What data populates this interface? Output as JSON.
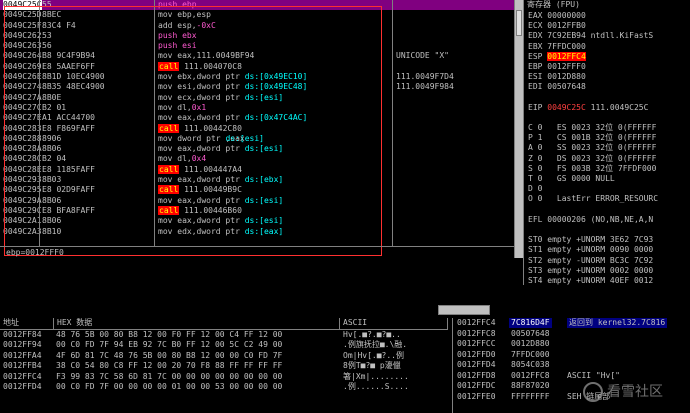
{
  "disasm": {
    "info": "ebp=0012FFF0",
    "lines": [
      {
        "addr": "0049C25C",
        "hex": "55",
        "asm": "push ebp",
        "kind": "push",
        "cmt": ""
      },
      {
        "addr": "0049C25D",
        "hex": "8BEC",
        "asm": "mov ebp,esp",
        "kind": "",
        "cmt": ""
      },
      {
        "addr": "0049C25F",
        "hex": "83C4 F4",
        "asm": "add esp,-0xC",
        "kind": "",
        "cmt": ""
      },
      {
        "addr": "0049C262",
        "hex": "53",
        "asm": "push ebx",
        "kind": "push",
        "cmt": ""
      },
      {
        "addr": "0049C263",
        "hex": "56",
        "asm": "push esi",
        "kind": "push",
        "cmt": ""
      },
      {
        "addr": "0049C264",
        "hex": "B8 9C4F9B94",
        "asm": "mov eax,111.0049BF94",
        "kind": "",
        "cmt": "UNICODE \"X\""
      },
      {
        "addr": "0049C269",
        "hex": "E8 5AAEF6FF",
        "asm": "111.004070C8",
        "kind": "call",
        "cmt": ""
      },
      {
        "addr": "0049C26E",
        "hex": "8B1D 10EC4900",
        "asm": "mov ebx,dword ptr ds:[0x49EC10]",
        "kind": "",
        "cmt": "111.0049F7D4"
      },
      {
        "addr": "0049C274",
        "hex": "8B35 48EC4900",
        "asm": "mov esi,dword ptr ds:[0x49EC48]",
        "kind": "",
        "cmt": "111.0049F984"
      },
      {
        "addr": "0049C27A",
        "hex": "8B0E",
        "asm": "mov ecx,dword ptr ds:[esi]",
        "kind": "",
        "cmt": ""
      },
      {
        "addr": "0049C27C",
        "hex": "B2 01",
        "asm": "mov dl,0x1",
        "kind": "",
        "cmt": ""
      },
      {
        "addr": "0049C27E",
        "hex": "A1 ACC44700",
        "asm": "mov eax,dword ptr ds:[0x47C4AC]",
        "kind": "",
        "cmt": ""
      },
      {
        "addr": "0049C283",
        "hex": "E8 F869FAFF",
        "asm": "111.00442C80",
        "kind": "call",
        "cmt": ""
      },
      {
        "addr": "0049C288",
        "hex": "8906",
        "asm": "mov dword ptr ds:[esi],eax",
        "kind": "",
        "cmt": ""
      },
      {
        "addr": "0049C28A",
        "hex": "8B06",
        "asm": "mov eax,dword ptr ds:[esi]",
        "kind": "",
        "cmt": ""
      },
      {
        "addr": "0049C28C",
        "hex": "B2 04",
        "asm": "mov dl,0x4",
        "kind": "",
        "cmt": ""
      },
      {
        "addr": "0049C28E",
        "hex": "E8 1185FAFF",
        "asm": "111.004447A4",
        "kind": "call",
        "cmt": ""
      },
      {
        "addr": "0049C293",
        "hex": "8B03",
        "asm": "mov eax,dword ptr ds:[ebx]",
        "kind": "",
        "cmt": ""
      },
      {
        "addr": "0049C295",
        "hex": "E8 02D9FAFF",
        "asm": "111.00449B9C",
        "kind": "call",
        "cmt": ""
      },
      {
        "addr": "0049C29A",
        "hex": "8B06",
        "asm": "mov eax,dword ptr ds:[esi]",
        "kind": "",
        "cmt": ""
      },
      {
        "addr": "0049C29C",
        "hex": "E8 BFA8FAFF",
        "asm": "111.00446B60",
        "kind": "call",
        "cmt": ""
      },
      {
        "addr": "0049C2A1",
        "hex": "8B06",
        "asm": "mov eax,dword ptr ds:[esi]",
        "kind": "",
        "cmt": ""
      },
      {
        "addr": "0049C2A3",
        "hex": "8B10",
        "asm": "mov edx,dword ptr ds:[eax]",
        "kind": "",
        "cmt": ""
      }
    ]
  },
  "registers": {
    "title": "寄存器 (FPU)",
    "lines": [
      "EAX 00000000",
      "ECX 0012FFB0",
      "EDX 7C92EB94 ntdll.KiFastS",
      "EBX 7FFDC000",
      "ESP_SEL",
      "EBP 0012FFF0",
      "ESI 0012D880",
      "EDI 00507648",
      "",
      "EIP_RED",
      "",
      "C 0   ES 0023 32位 0(FFFFFF",
      "P 1   CS 001B 32位 0(FFFFFF",
      "A 0   SS 0023 32位 0(FFFFFF",
      "Z 0   DS 0023 32位 0(FFFFFF",
      "S 0   FS 003B 32位 7FFDF000",
      "T 0   GS 0000 NULL",
      "D 0",
      "O 0   LastErr ERROR_RESOURC",
      "",
      "EFL 00000206 (NO,NB,NE,A,N",
      "",
      "ST0 empty +UNORM 3E62 7C93",
      "ST1 empty +UNORM 0090 0000",
      "ST2 empty -UNORM BC3C 7C92",
      "ST3 empty +UNORM 0002 0000",
      "ST4 empty +UNORM 40EF 0012"
    ],
    "esp_label": "ESP",
    "esp_value": "0012FFC4",
    "eip_label": "EIP",
    "eip_value": "0049C25C",
    "eip_rest": "111.0049C25C"
  },
  "dump": {
    "h_addr": "地址",
    "h_hex": "HEX 数据",
    "h_ascii": "ASCII",
    "rows": [
      {
        "addr": "0012FF84",
        "hex": "48 76 5B 00 80 B8 12 00 F0 FF 12 00 C4 FF 12 00",
        "ascii": "Hv[.■?.■?■.."
      },
      {
        "addr": "0012FF94",
        "hex": "00 C0 FD 7F 94 EB 92 7C B0 FF 12 00 5C C2 49 00",
        "ascii": ".例旗抚拉■.\\融."
      },
      {
        "addr": "0012FFA4",
        "hex": "4F 6D 81 7C 48 76 5B 00 80 B8 12 00 00 C0 FD 7F",
        "ascii": "Om|Hv[.■?..例"
      },
      {
        "addr": "0012FFB4",
        "hex": "38 C0 54 80 C8 FF 12 00 20 70 F8 88 FF FF FF FF",
        "ascii": "8例T■?■ p瀀儠"
      },
      {
        "addr": "0012FFC4",
        "hex": "F3 99 83 7C 58 6D 81 7C 00 00 00 00 00 00 00 00",
        "ascii": "箸|Xm|........"
      },
      {
        "addr": "0012FFD4",
        "hex": "00 C0 FD 7F 00 00 00 00 01 00 00 53 00 00 00 00",
        "ascii": ".例......S...."
      }
    ]
  },
  "stack": {
    "header_addr": "0012FFC4",
    "header_val": "7C816D4F",
    "header_cmt": "返回到 kernel32.7C816",
    "rows": [
      {
        "addr": "0012FFC8",
        "val": "00507648",
        "cmt": ""
      },
      {
        "addr": "0012FFCC",
        "val": "0012D880",
        "cmt": ""
      },
      {
        "addr": "0012FFD0",
        "val": "7FFDC000",
        "cmt": ""
      },
      {
        "addr": "0012FFD4",
        "val": "8054C038",
        "cmt": ""
      },
      {
        "addr": "0012FFD8",
        "val": "0012FFC8",
        "cmt": "ASCII \"Hv[\""
      },
      {
        "addr": "0012FFDC",
        "val": "88F87020",
        "cmt": ""
      },
      {
        "addr": "0012FFE0",
        "val": "FFFFFFFF",
        "cmt": "SEH 链尾部"
      }
    ]
  },
  "watermark": "看雪社区"
}
